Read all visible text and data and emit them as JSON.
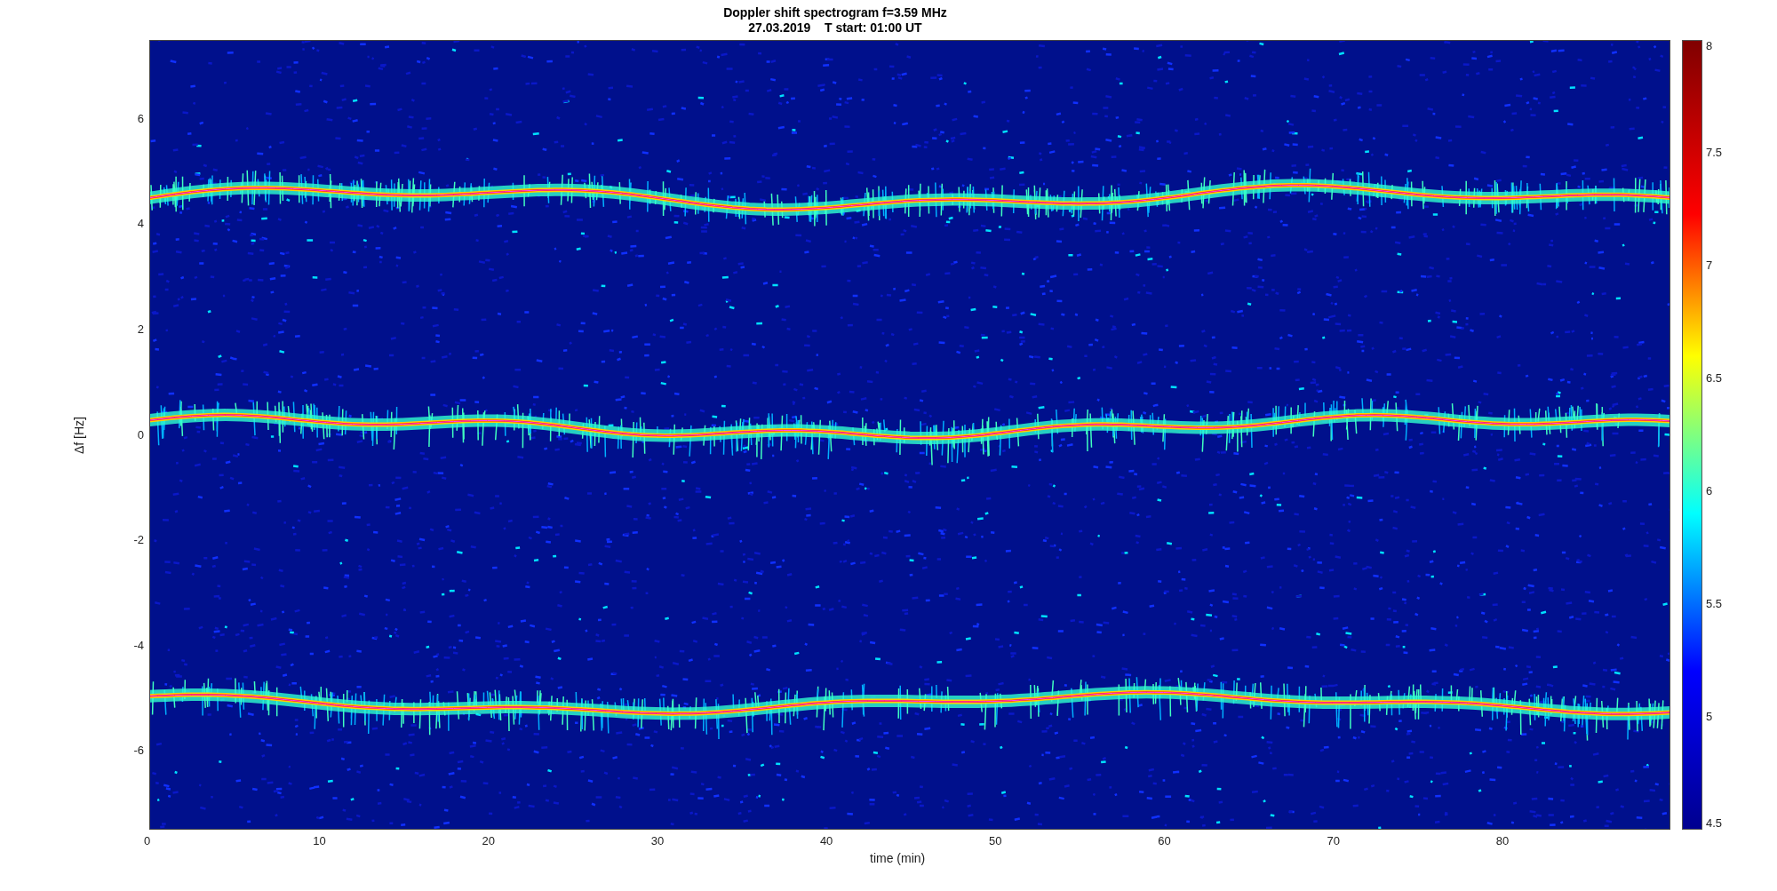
{
  "figure": {
    "title": [
      "Doppler shift spectrogram f=3.59 MHz",
      "27.03.2019    T start: 01:00 UT"
    ],
    "xlabel": "time (min)",
    "ylabel": "Δf [Hz]",
    "xticks": [
      "0",
      "10",
      "20",
      "30",
      "40",
      "50",
      "60",
      "70",
      "80"
    ],
    "yticks": [
      "6",
      "4",
      "2",
      "0",
      "-2",
      "-4",
      "-6"
    ],
    "colorbar_ticks": [
      "8",
      "7.5",
      "7",
      "6.5",
      "6",
      "5.5",
      "5",
      "4.5"
    ]
  }
}
